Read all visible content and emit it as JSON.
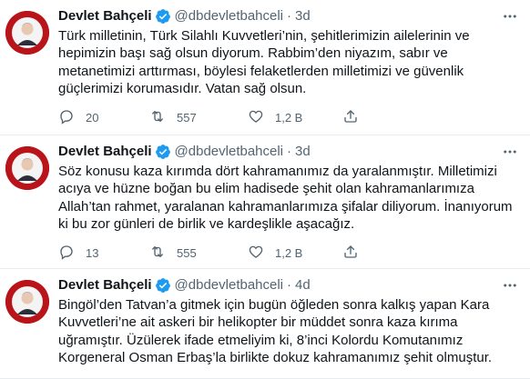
{
  "tweets": [
    {
      "name": "Devlet Bahçeli",
      "handle": "@dbdevletbahceli",
      "separator": "·",
      "time": "3d",
      "text": "Türk milletinin, Türk Silahlı Kuvvetleri’nin, şehitlerimizin ailelerinin ve hepimizin başı sağ olsun diyorum. Rabbim’den niyazım, sabır ve metanetimizi arttırması, böylesi felaketlerden milletimizi ve güvenlik güçlerimizi korumasıdır. Vatan sağ olsun.",
      "replies": "20",
      "retweets": "557",
      "likes": "1,2 B"
    },
    {
      "name": "Devlet Bahçeli",
      "handle": "@dbdevletbahceli",
      "separator": "·",
      "time": "3d",
      "text": "Söz konusu kaza kırımda dört kahramanımız da yaralanmıştır. Milletimizi acıya ve hüzne boğan bu elim hadisede şehit olan kahramanlarımıza Allah’tan rahmet, yaralanan kahramanlarımıza şifalar diliyorum. İnanıyorum ki bu zor günleri de birlik ve kardeşlikle aşacağız.",
      "replies": "13",
      "retweets": "555",
      "likes": "1,2 B"
    },
    {
      "name": "Devlet Bahçeli",
      "handle": "@dbdevletbahceli",
      "separator": "·",
      "time": "4d",
      "text": "Bingöl’den Tatvan’a gitmek için bugün öğleden sonra kalkış yapan Kara Kuvvetleri’ne ait askeri bir helikopter bir müddet sonra kaza kırıma uğramıştır. Üzülerek ifade etmeliyim ki, 8’inci Kolordu Komutanımız Korgeneral Osman Erbaş’la birlikte dokuz kahramanımız şehit olmuştur."
    }
  ],
  "icons": {
    "verified": "verified-badge-icon",
    "more": "more-options-icon",
    "reply": "reply-icon",
    "retweet": "retweet-icon",
    "like": "heart-icon",
    "share": "share-icon"
  },
  "colors": {
    "verified_blue": "#1d9bf0",
    "secondary_text": "#536471",
    "primary_text": "#0f1419",
    "divider": "#e6ecf0",
    "avatar_red": "#b8141a"
  }
}
